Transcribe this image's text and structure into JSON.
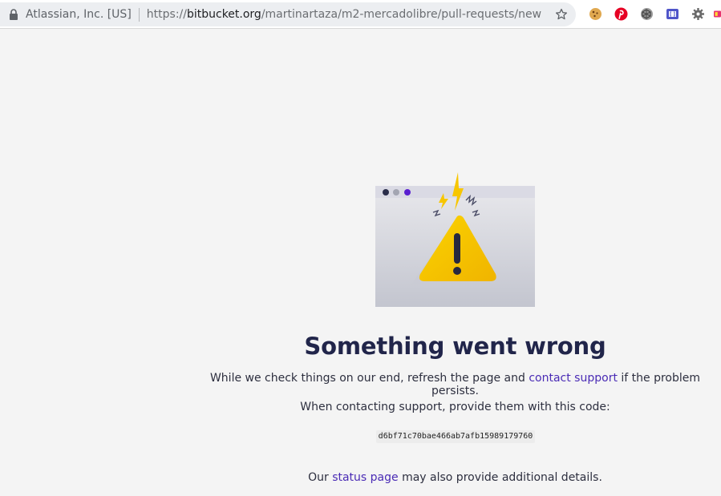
{
  "browser": {
    "site_identity": "Atlassian, Inc. [US]",
    "url_scheme": "https://",
    "url_host": "bitbucket.org",
    "url_path": "/martinartaza/m2-mercadolibre/pull-requests/new",
    "extension_icons": [
      "cookie-icon",
      "pinterest-icon",
      "puzzle-ball-icon",
      "bracket-extension-icon",
      "gear-icon",
      "color-extension-icon"
    ]
  },
  "error": {
    "title": "Something went wrong",
    "line1_before": "While we check things on our end, refresh the page and ",
    "line1_link": "contact support",
    "line1_after": " if the problem persists.",
    "line2": "When contacting support, provide them with this code:",
    "code": "d6bf71c70bae466ab7afb15989179760",
    "line3_before": "Our ",
    "line3_link": "status page",
    "line3_after": " may also provide additional details."
  },
  "colors": {
    "accent_link": "#4a2bb5",
    "warning_yellow": "#f7c600",
    "title": "#21254a"
  }
}
